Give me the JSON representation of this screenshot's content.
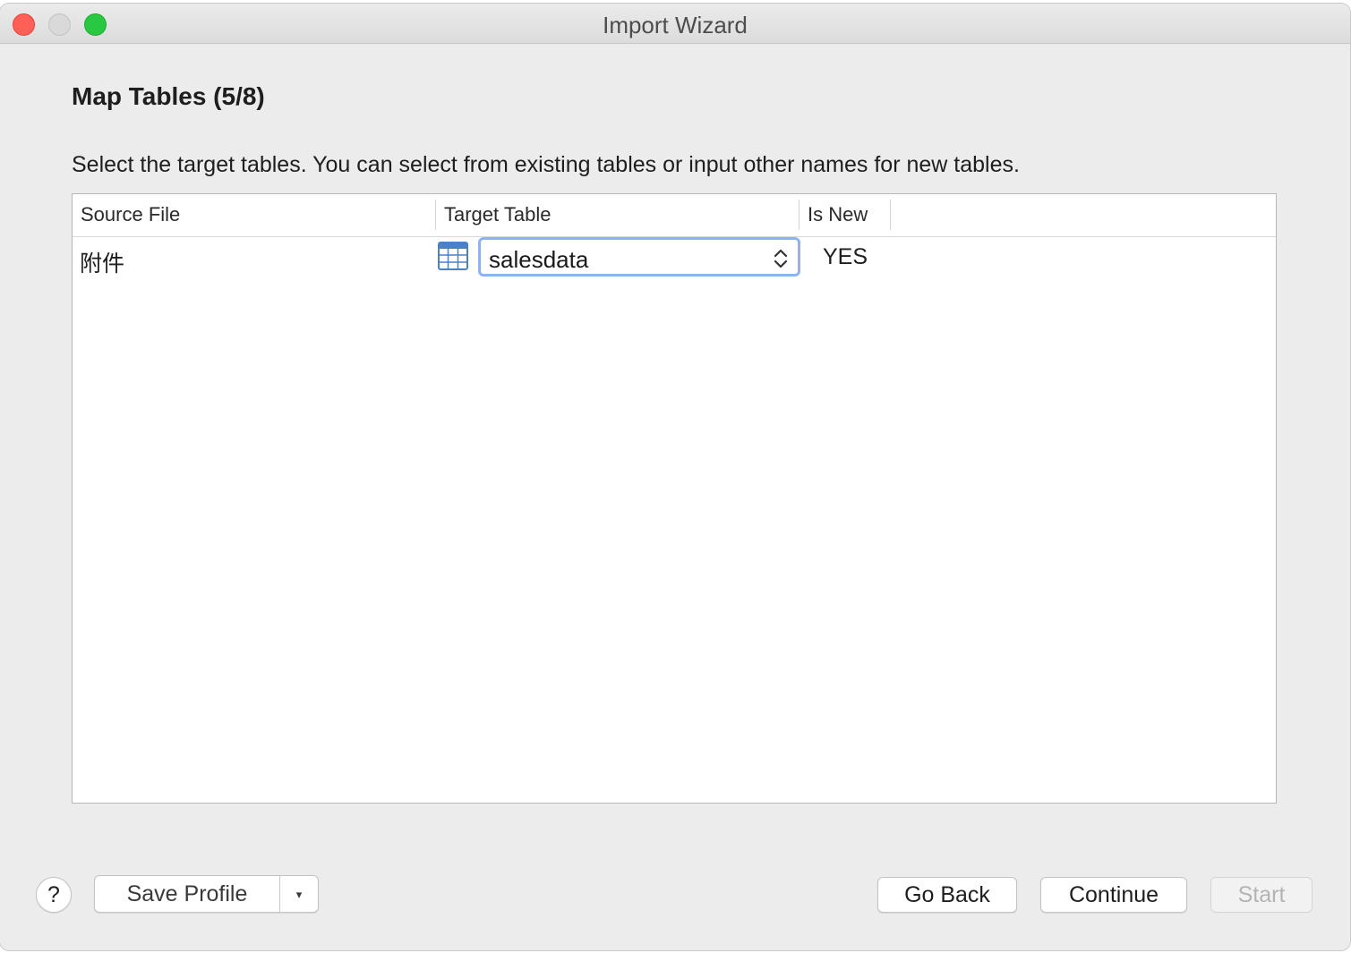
{
  "window": {
    "title": "Import Wizard"
  },
  "header": {
    "step_title": "Map Tables (5/8)",
    "instructions": "Select the target tables. You can select from existing tables or input other names for new tables."
  },
  "table": {
    "columns": [
      "Source File",
      "Target Table",
      "Is New"
    ],
    "rows": [
      {
        "source_file": "附件",
        "target_table": "salesdata",
        "is_new": "YES"
      }
    ]
  },
  "footer": {
    "help_label": "?",
    "save_profile_label": "Save Profile",
    "dropdown_glyph": "▾",
    "go_back_label": "Go Back",
    "continue_label": "Continue",
    "start_label": "Start"
  },
  "icons": {
    "close": "close-icon",
    "minimize": "minimize-icon",
    "maximize": "maximize-icon",
    "table": "table-grid-icon",
    "stepper": "up-down-chevron-icon"
  },
  "colors": {
    "close": "#fe5f57",
    "minimize_inactive": "#d9d9d9",
    "maximize": "#28c840",
    "focus_ring": "#8fb3ef",
    "table_icon": "#4a82c4"
  }
}
